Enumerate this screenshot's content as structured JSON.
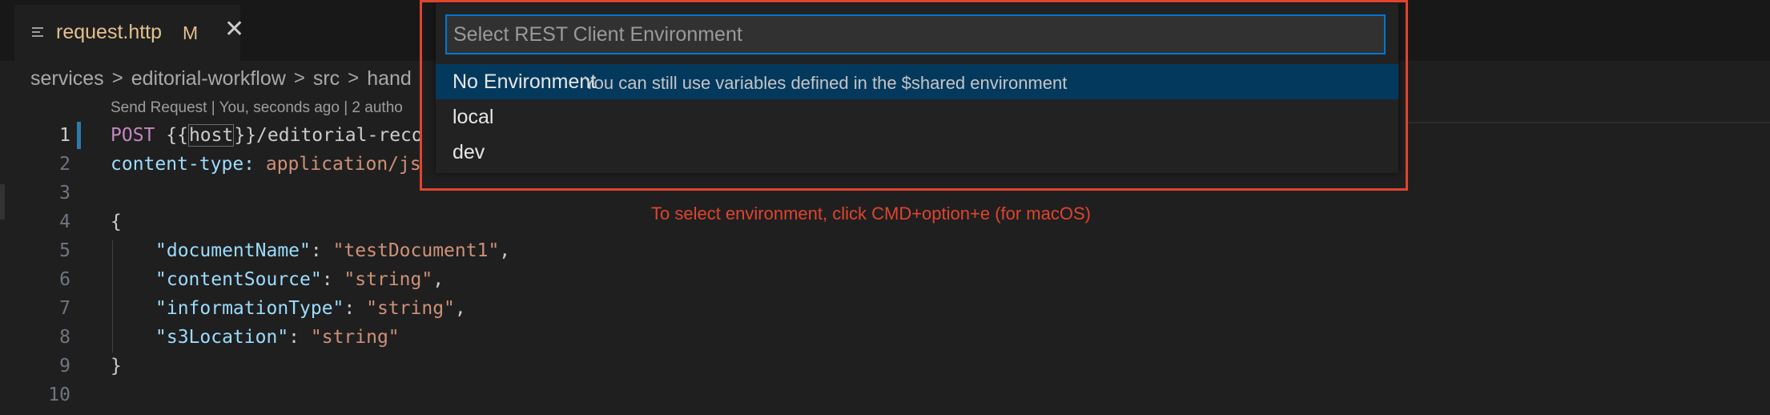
{
  "tab": {
    "filename": "request.http",
    "modified_badge": "M",
    "close_glyph": "✕"
  },
  "breadcrumb": [
    "services",
    "editorial-workflow",
    "src",
    "hand"
  ],
  "codelens": "Send Request | You, seconds ago | 2 autho",
  "lines": [
    {
      "num": "1"
    },
    {
      "num": "2"
    },
    {
      "num": "3"
    },
    {
      "num": "4"
    },
    {
      "num": "5"
    },
    {
      "num": "6"
    },
    {
      "num": "7"
    },
    {
      "num": "8"
    },
    {
      "num": "9"
    },
    {
      "num": "10"
    }
  ],
  "code": {
    "l1_method": "POST",
    "l1_open": " {{",
    "l1_host": "host",
    "l1_close": "}}",
    "l1_path": "/editorial-reco",
    "l2_key": "content-type:",
    "l2_val": " application/js",
    "l4": "{",
    "l5_key": "\"documentName\"",
    "l5_val": "\"testDocument1\"",
    "l6_key": "\"contentSource\"",
    "l6_val": "\"string\"",
    "l7_key": "\"informationType\"",
    "l7_val": "\"string\"",
    "l8_key": "\"s3Location\"",
    "l8_val": "\"string\"",
    "l9": "}",
    "colon": ": ",
    "comma": ","
  },
  "quickpick": {
    "placeholder": "Select REST Client Environment",
    "items": [
      {
        "label": "No Environment",
        "description": "You can still use variables defined in the $shared environment"
      },
      {
        "label": "local",
        "description": ""
      },
      {
        "label": "dev",
        "description": ""
      }
    ]
  },
  "annotation": "To select environment, click CMD+option+e (for macOS)",
  "colors": {
    "accent": "#0078d4",
    "annotation": "#e0442f",
    "selected_item": "#04395e"
  },
  "icons": {
    "tab_file": "lines-icon",
    "tab_close": "close-icon",
    "breadcrumb_sep": "chevron-right-icon"
  }
}
